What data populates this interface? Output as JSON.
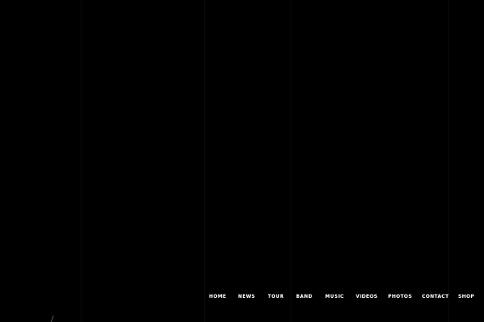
{
  "nav": {
    "items": [
      {
        "label": "HOME"
      },
      {
        "label": "NEWS"
      },
      {
        "label": "TOUR"
      },
      {
        "label": "BAND"
      },
      {
        "label": "MUSIC"
      },
      {
        "label": "VIDEOS"
      },
      {
        "label": "PHOTOS"
      },
      {
        "label": "CONTACT"
      },
      {
        "label": "SHOP"
      }
    ]
  },
  "colors": {
    "background": "#000000",
    "nav_text": "#ffffff"
  }
}
